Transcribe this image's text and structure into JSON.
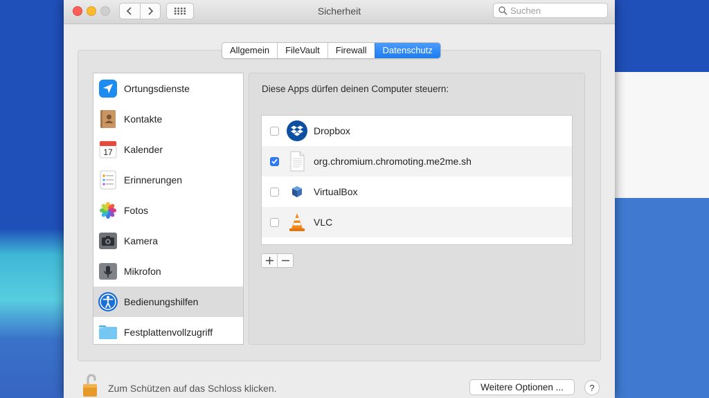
{
  "window": {
    "title": "Sicherheit"
  },
  "search": {
    "placeholder": "Suchen"
  },
  "tabs": [
    {
      "label": "Allgemein",
      "active": false
    },
    {
      "label": "FileVault",
      "active": false
    },
    {
      "label": "Firewall",
      "active": false
    },
    {
      "label": "Datenschutz",
      "active": true
    }
  ],
  "sidebar": {
    "items": [
      {
        "label": "Ortungsdienste",
        "icon": "location-arrow-icon"
      },
      {
        "label": "Kontakte",
        "icon": "contacts-book-icon"
      },
      {
        "label": "Kalender",
        "icon": "calendar-icon",
        "icon_text": "17"
      },
      {
        "label": "Erinnerungen",
        "icon": "reminders-icon"
      },
      {
        "label": "Fotos",
        "icon": "photos-icon"
      },
      {
        "label": "Kamera",
        "icon": "camera-icon"
      },
      {
        "label": "Mikrofon",
        "icon": "microphone-icon"
      },
      {
        "label": "Bedienungshilfen",
        "icon": "accessibility-icon",
        "selected": true
      },
      {
        "label": "Festplattenvollzugriff",
        "icon": "folder-icon"
      }
    ]
  },
  "content": {
    "heading": "Diese Apps dürfen deinen Computer steuern:",
    "apps": [
      {
        "label": "Dropbox",
        "checked": false,
        "icon": "dropbox-icon"
      },
      {
        "label": "org.chromium.chromoting.me2me.sh",
        "checked": true,
        "icon": "document-icon"
      },
      {
        "label": "VirtualBox",
        "checked": false,
        "icon": "virtualbox-icon"
      },
      {
        "label": "VLC",
        "checked": false,
        "icon": "vlc-cone-icon"
      }
    ]
  },
  "footer": {
    "lock_text": "Zum Schützen auf das Schloss klicken.",
    "more_button": "Weitere Optionen ...",
    "help": "?"
  },
  "colors": {
    "accent": "#1e7cf0",
    "selection": "#dcdcdc"
  }
}
